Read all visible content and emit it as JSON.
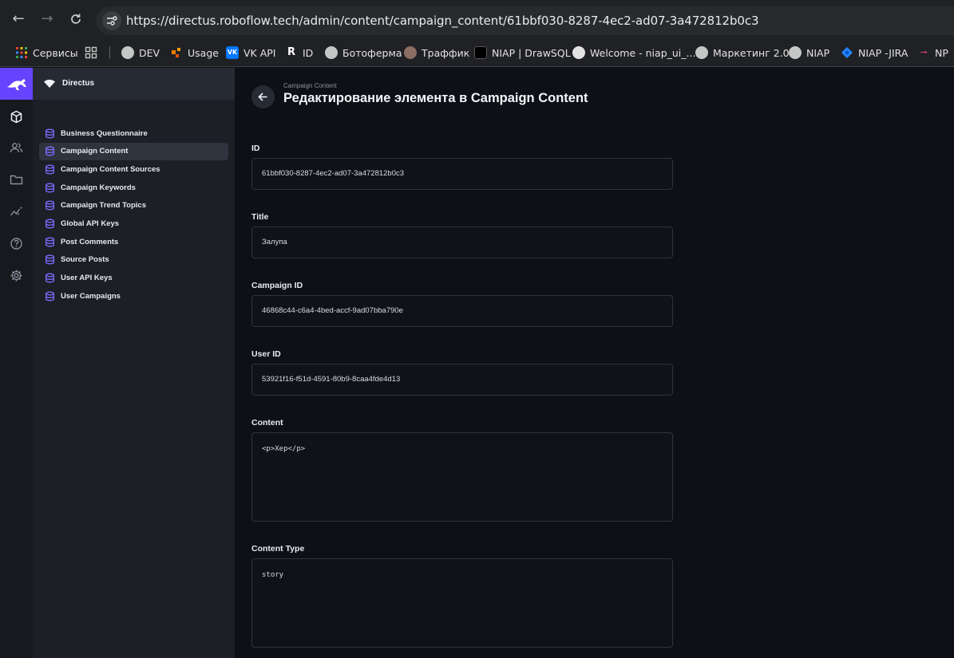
{
  "browser": {
    "url": "https://directus.roboflow.tech/admin/content/campaign_content/61bbf030-8287-4ec2-ad07-3a472812b0c3",
    "bookmarks": [
      {
        "label": "Сервисы",
        "icon": "apps-grid-icon"
      },
      {
        "label": "",
        "icon": "grid-icon"
      },
      {
        "label": "DEV",
        "icon": "globe-icon"
      },
      {
        "label": "Usage",
        "icon": "usage-icon"
      },
      {
        "label": "VK API",
        "icon": "vk-icon"
      },
      {
        "label": "ID",
        "icon": "r-icon"
      },
      {
        "label": "Ботоферма",
        "icon": "globe-icon"
      },
      {
        "label": "Траффик",
        "icon": "traffic-icon"
      },
      {
        "label": "NIAP | DrawSQL",
        "icon": "drawsql-icon"
      },
      {
        "label": "Welcome - niap_ui_...",
        "icon": "github-icon"
      },
      {
        "label": "Маркетинг 2.0",
        "icon": "globe-icon"
      },
      {
        "label": "NIAP",
        "icon": "globe-icon"
      },
      {
        "label": "NIAP -JIRA",
        "icon": "jira-icon"
      },
      {
        "label": "NP",
        "icon": "np-icon"
      }
    ]
  },
  "sidebar": {
    "title": "Directus",
    "items": [
      {
        "label": "Business Questionnaire",
        "active": false
      },
      {
        "label": "Campaign Content",
        "active": true
      },
      {
        "label": "Campaign Content Sources",
        "active": false
      },
      {
        "label": "Campaign Keywords",
        "active": false
      },
      {
        "label": "Campaign Trend Topics",
        "active": false
      },
      {
        "label": "Global API Keys",
        "active": false
      },
      {
        "label": "Post Comments",
        "active": false
      },
      {
        "label": "Source Posts",
        "active": false
      },
      {
        "label": "User API Keys",
        "active": false
      },
      {
        "label": "User Campaigns",
        "active": false
      }
    ]
  },
  "header": {
    "breadcrumb": "Campaign Content",
    "title": "Редактирование элемента в Campaign Content"
  },
  "form": {
    "fields": [
      {
        "label": "ID",
        "value": "61bbf030-8287-4ec2-ad07-3a472812b0c3"
      },
      {
        "label": "Title",
        "value": "Залупа"
      },
      {
        "label": "Campaign ID",
        "value": "46868c44-c6a4-4bed-accf-9ad07bba790e"
      },
      {
        "label": "User ID",
        "value": "53921f16-f51d-4591-80b9-8caa4fde4d13"
      },
      {
        "label": "Content",
        "value": "<p>Хер</p>"
      },
      {
        "label": "Content Type",
        "value": "story"
      }
    ]
  },
  "colors": {
    "accent": "#6644ff",
    "background": "#0d1015",
    "sidebar": "#1c1f26"
  }
}
